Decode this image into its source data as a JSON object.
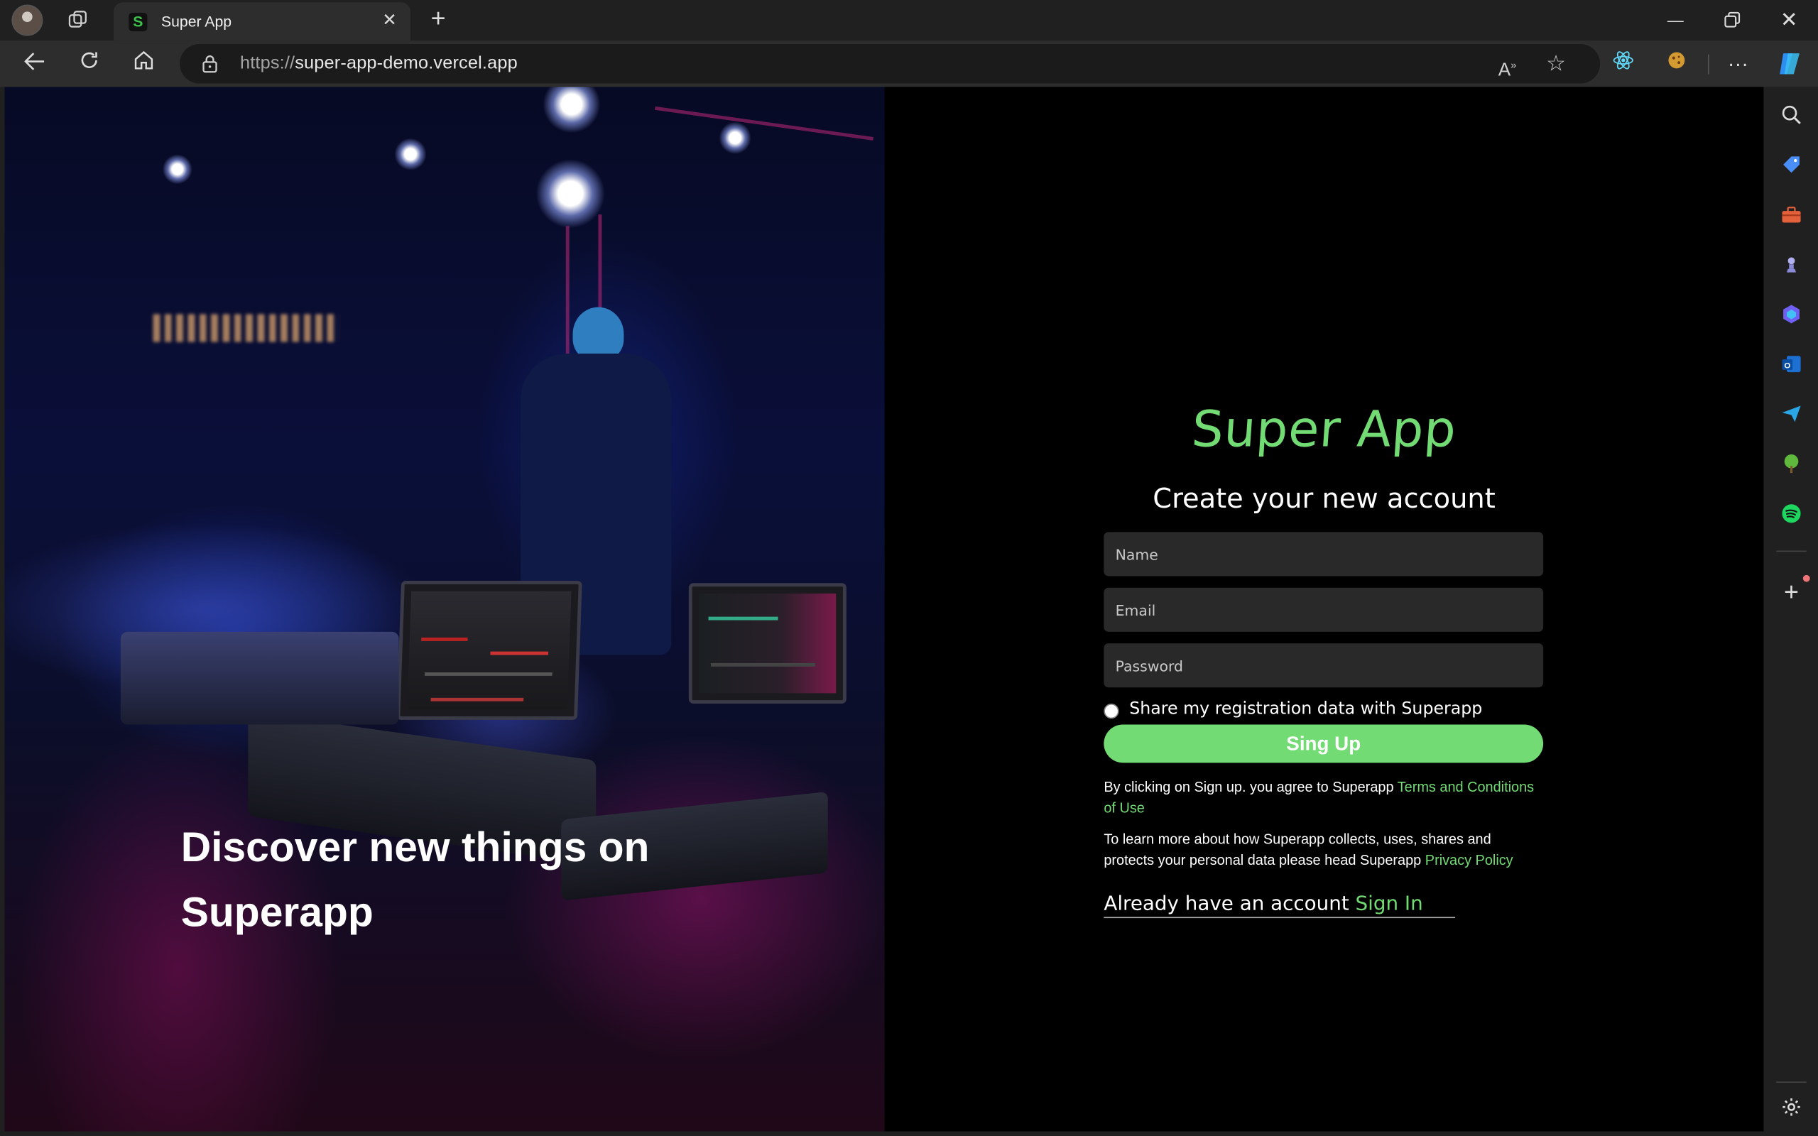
{
  "browser": {
    "tab_title": "Super App",
    "tab_favicon_letter": "S",
    "url_protocol": "https://",
    "url_host": "super-app-demo.vercel.app",
    "sidebar_icons": [
      "search-icon",
      "tag-icon",
      "toolbox-icon",
      "chess-icon",
      "copilot-icon",
      "outlook-icon",
      "send-icon",
      "tree-icon",
      "spotify-icon",
      "add-icon",
      "settings-icon"
    ]
  },
  "hero": {
    "headline": "Discover new things on Superapp"
  },
  "signup": {
    "brand": "Super App",
    "subtitle": "Create your new account",
    "name_placeholder": "Name",
    "email_placeholder": "Email",
    "password_placeholder": "Password",
    "share_label": "Share my registration data with Superapp",
    "button_label": "Sing Up",
    "terms_text": "By clicking on Sign up. you agree to Superapp ",
    "terms_link": "Terms and Conditions of Use",
    "privacy_text": "To learn more about how Superapp collects, uses, shares and protects your personal data please head Superapp ",
    "privacy_link": "Privacy Policy",
    "have_account_text": "Already have an account ",
    "signin_link": "Sign In"
  },
  "colors": {
    "accent": "#72DB73",
    "background": "#000000",
    "input_bg": "#292929"
  }
}
